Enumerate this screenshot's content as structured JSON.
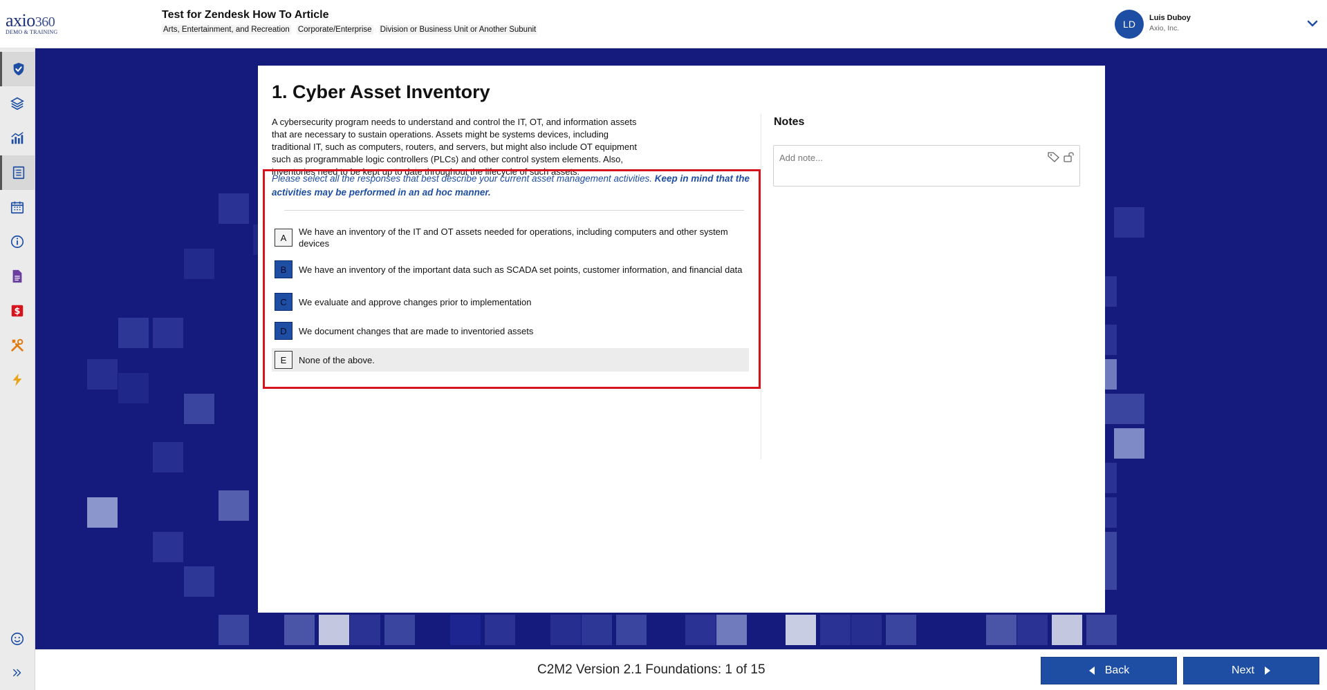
{
  "brand": {
    "logo_main": "axio",
    "logo_num": "360",
    "logo_sub": "DEMO & TRAINING",
    "accent": "#1d4ea3"
  },
  "header": {
    "title": "Test for Zendesk How To Article",
    "tags": [
      "Arts, Entertainment, and Recreation",
      "Corporate/Enterprise",
      "Division or Business Unit or Another Subunit"
    ]
  },
  "user": {
    "initials": "LD",
    "name": "Luis Duboy",
    "org": "Axio, Inc."
  },
  "sidebar": {
    "items": [
      {
        "icon": "shield-check-icon",
        "active": true
      },
      {
        "icon": "layers-icon",
        "active": false
      },
      {
        "icon": "analytics-chart-icon",
        "active": false
      },
      {
        "icon": "list-document-icon",
        "active": true
      },
      {
        "icon": "calendar-icon",
        "active": false
      },
      {
        "icon": "info-icon",
        "active": false
      },
      {
        "icon": "file-icon",
        "active": false
      },
      {
        "icon": "dollar-icon",
        "active": false
      },
      {
        "icon": "tools-icon",
        "active": false
      },
      {
        "icon": "lightning-icon",
        "active": false
      }
    ],
    "bottom": [
      "smiley-icon",
      "expand-chevrons-icon"
    ]
  },
  "question": {
    "title": "1. Cyber Asset Inventory",
    "description": "A cybersecurity program needs to understand and control the IT, OT, and information assets that are necessary to sustain operations. Assets might be systems devices, including traditional IT, such as computers, routers, and servers, but might also include OT equipment such as programmable logic controllers (PLCs) and other control system elements. Also, inventories need to be kept up to date throughout the lifecycle of such assets.",
    "instruction_italic": "Please select all the responses that best describe your current asset management activities. ",
    "instruction_bold": "Keep in mind that the activities may be performed in an ad hoc manner.",
    "options": [
      {
        "letter": "A",
        "text": "We have an inventory of the IT and OT assets needed for operations, including computers and other system devices",
        "selected": false
      },
      {
        "letter": "B",
        "text": "We have an inventory of the important data such as SCADA set points, customer information, and financial data",
        "selected": true
      },
      {
        "letter": "C",
        "text": "We evaluate and approve changes prior to implementation",
        "selected": true
      },
      {
        "letter": "D",
        "text": "We document changes that are made to inventoried assets",
        "selected": true
      },
      {
        "letter": "E",
        "text": "None of the above.",
        "selected": false
      }
    ]
  },
  "notes": {
    "title": "Notes",
    "placeholder": "Add note..."
  },
  "footer": {
    "progress": "C2M2 Version 2.1 Foundations: 1 of 15",
    "back_label": "Back",
    "next_label": "Next"
  }
}
